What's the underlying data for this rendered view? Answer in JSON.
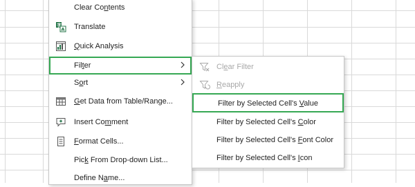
{
  "colors": {
    "grid_line": "#d9d9d9",
    "highlight": "#35a853",
    "icon_green": "#217346",
    "icon_gray": "#6b6b6b",
    "disabled": "#a8a8a8"
  },
  "context_menu": {
    "items": [
      {
        "before": "Clear Co",
        "acc": "n",
        "after": "tents",
        "icon": ""
      },
      {
        "before": "",
        "acc": "",
        "after": "Translate",
        "icon": "translate-icon"
      },
      {
        "before": "",
        "acc": "Q",
        "after": "uick Analysis",
        "icon": "quick-analysis-icon"
      },
      {
        "before": "Fil",
        "acc": "t",
        "after": "er",
        "icon": "",
        "submenu": true,
        "highlighted": true
      },
      {
        "before": "S",
        "acc": "o",
        "after": "rt",
        "icon": "",
        "submenu": true
      },
      {
        "before": "",
        "acc": "G",
        "after": "et Data from Table/Range...",
        "icon": "table-icon"
      },
      {
        "before": "Insert Co",
        "acc": "m",
        "after": "ment",
        "icon": "comment-icon"
      },
      {
        "before": "",
        "acc": "F",
        "after": "ormat Cells...",
        "icon": "format-cells-icon"
      },
      {
        "before": "Pic",
        "acc": "k",
        "after": " From Drop-down List...",
        "icon": ""
      },
      {
        "before": "Define N",
        "acc": "a",
        "after": "me...",
        "icon": ""
      }
    ]
  },
  "filter_submenu": {
    "items": [
      {
        "before": "Cl",
        "acc": "e",
        "after": "ar Filter",
        "icon": "clear-filter-icon",
        "disabled": true
      },
      {
        "before": "",
        "acc": "R",
        "after": "eapply",
        "icon": "reapply-icon",
        "disabled": true
      },
      {
        "before": "Filter by Selected Cell's ",
        "acc": "V",
        "after": "alue",
        "icon": "",
        "highlighted": true
      },
      {
        "before": "Filter by Selected Cell's ",
        "acc": "C",
        "after": "olor",
        "icon": ""
      },
      {
        "before": "Filter by Selected Cell's ",
        "acc": "F",
        "after": "ont Color",
        "icon": ""
      },
      {
        "before": "Filter by Selected Cell's ",
        "acc": "I",
        "after": "con",
        "icon": ""
      }
    ]
  }
}
